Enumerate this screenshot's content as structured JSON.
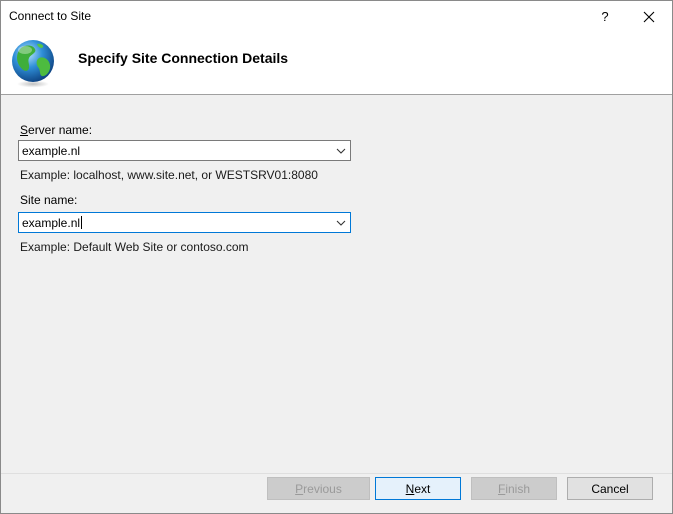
{
  "window": {
    "title": "Connect to Site",
    "help_label": "?"
  },
  "header": {
    "title": "Specify Site Connection Details"
  },
  "form": {
    "server_label": "Server name:",
    "server_value": "example.nl",
    "server_hint": "Example: localhost, www.site.net, or WESTSRV01:8080",
    "site_label": "Site name:",
    "site_value": "example.nl",
    "site_hint": "Example: Default Web Site or contoso.com"
  },
  "buttons": {
    "previous": "Previous",
    "next": "Next",
    "finish": "Finish",
    "cancel": "Cancel"
  },
  "colors": {
    "focus_border": "#0078d7",
    "disabled_text": "#9a9a9a"
  }
}
